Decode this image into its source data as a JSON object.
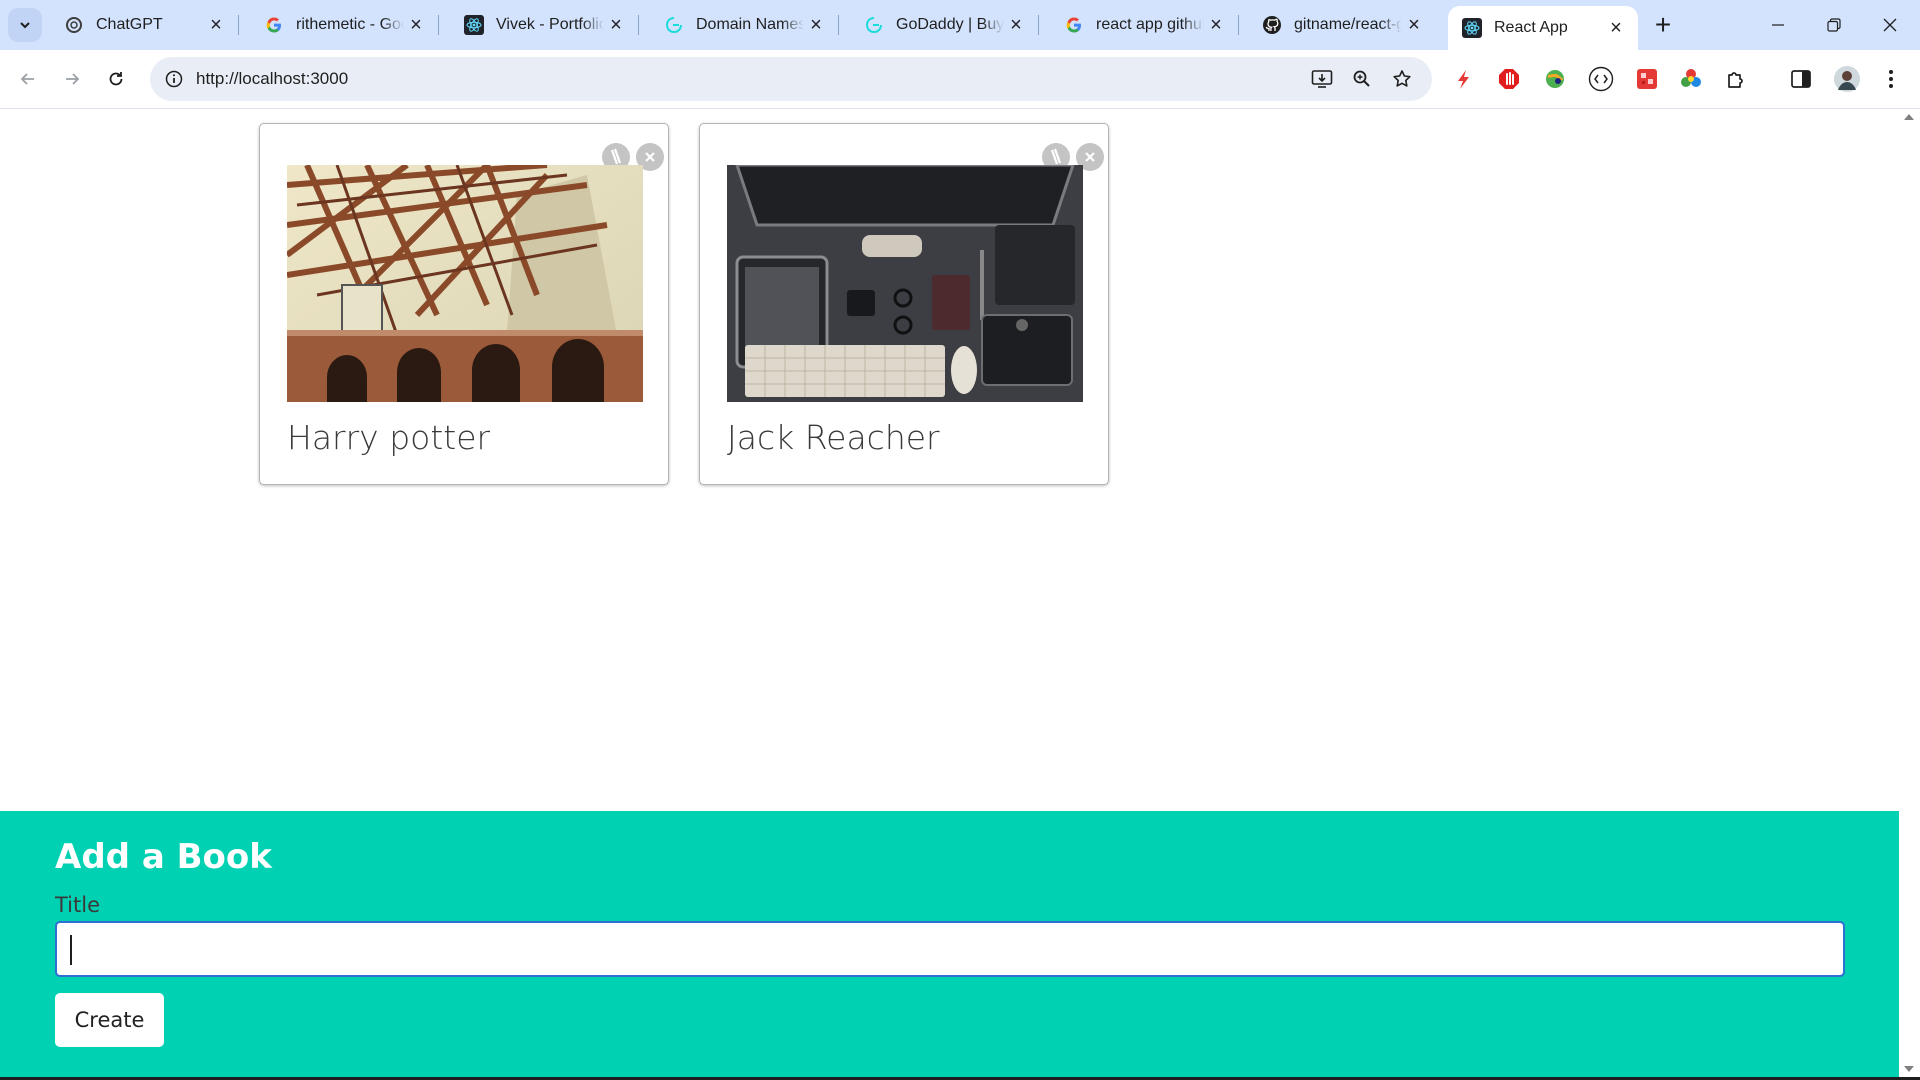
{
  "browser": {
    "tabs": [
      {
        "title": "ChatGPT",
        "icon": "chatgpt-icon"
      },
      {
        "title": "rithemetic - Google",
        "icon": "google-icon"
      },
      {
        "title": "Vivek - Portfolio",
        "icon": "react-icon"
      },
      {
        "title": "Domain Names, Websi",
        "icon": "godaddy-icon"
      },
      {
        "title": "GoDaddy | Buy Domai",
        "icon": "godaddy-icon"
      },
      {
        "title": "react app github",
        "icon": "google-icon"
      },
      {
        "title": "gitname/react-gh-pag",
        "icon": "github-icon"
      },
      {
        "title": "React App",
        "icon": "react-icon",
        "active": true
      }
    ],
    "url": "http://localhost:3000",
    "accent": "#d3e3fd"
  },
  "books": [
    {
      "title": "Harry potter",
      "image": "golden-gate-bridge-steel-structure"
    },
    {
      "title": "Jack Reacher",
      "image": "desk-flatlay-computer-keyboard"
    }
  ],
  "form": {
    "heading": "Add a Book",
    "title_label": "Title",
    "title_value": "",
    "submit_label": "Create",
    "background": "#00d1b2"
  }
}
